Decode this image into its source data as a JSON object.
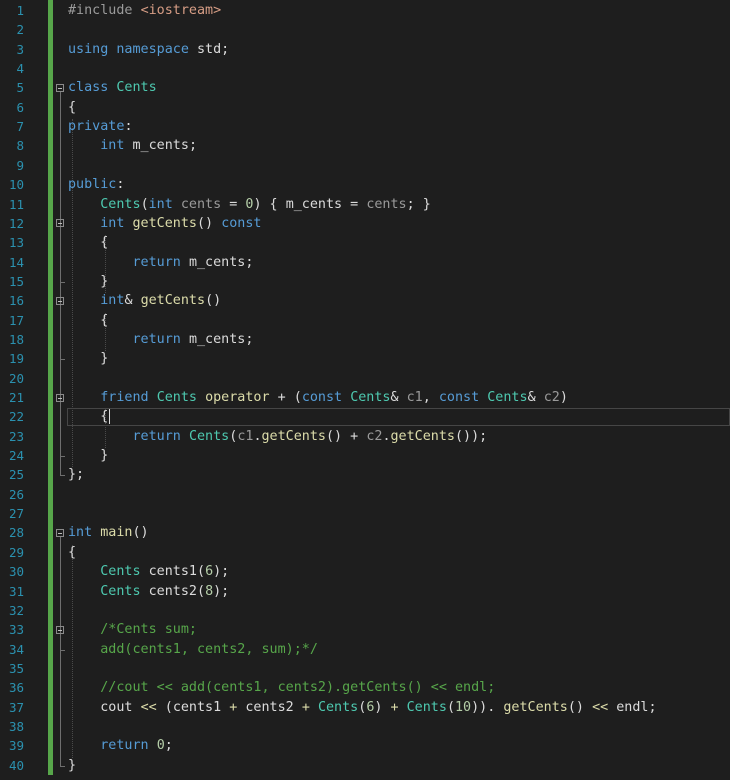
{
  "editor": {
    "line_numbers": [
      "1",
      "2",
      "3",
      "4",
      "5",
      "6",
      "7",
      "8",
      "9",
      "10",
      "11",
      "12",
      "13",
      "14",
      "15",
      "16",
      "17",
      "18",
      "19",
      "20",
      "21",
      "22",
      "23",
      "24",
      "25",
      "26",
      "27",
      "28",
      "29",
      "30",
      "31",
      "32",
      "33",
      "34",
      "35",
      "36",
      "37",
      "38",
      "39",
      "40"
    ],
    "current_line": 22,
    "lines": [
      [
        [
          "pp",
          "#include "
        ],
        [
          "st",
          "<iostream>"
        ]
      ],
      [],
      [
        [
          "kw",
          "using"
        ],
        [
          "tx",
          " "
        ],
        [
          "kw",
          "namespace"
        ],
        [
          "tx",
          " std;"
        ]
      ],
      [],
      [
        [
          "kw",
          "class"
        ],
        [
          "tx",
          " "
        ],
        [
          "ty",
          "Cents"
        ]
      ],
      [
        [
          "tx",
          "{"
        ]
      ],
      [
        [
          "kw",
          "private"
        ],
        [
          "tx",
          ":"
        ]
      ],
      [
        [
          "tx",
          "    "
        ],
        [
          "kw",
          "int"
        ],
        [
          "tx",
          " "
        ],
        [
          "mb",
          "m_cents"
        ],
        [
          "tx",
          ";"
        ]
      ],
      [],
      [
        [
          "kw",
          "public"
        ],
        [
          "tx",
          ":"
        ]
      ],
      [
        [
          "tx",
          "    "
        ],
        [
          "ty",
          "Cents"
        ],
        [
          "tx",
          "("
        ],
        [
          "kw",
          "int"
        ],
        [
          "tx",
          " "
        ],
        [
          "pm",
          "cents"
        ],
        [
          "tx",
          " = "
        ],
        [
          "nm",
          "0"
        ],
        [
          "tx",
          ") { "
        ],
        [
          "mb",
          "m_cents"
        ],
        [
          "tx",
          " = "
        ],
        [
          "pm",
          "cents"
        ],
        [
          "tx",
          "; }"
        ]
      ],
      [
        [
          "tx",
          "    "
        ],
        [
          "kw",
          "int"
        ],
        [
          "tx",
          " "
        ],
        [
          "fn",
          "getCents"
        ],
        [
          "tx",
          "() "
        ],
        [
          "kw",
          "const"
        ]
      ],
      [
        [
          "tx",
          "    {"
        ]
      ],
      [
        [
          "tx",
          "        "
        ],
        [
          "kw",
          "return"
        ],
        [
          "tx",
          " "
        ],
        [
          "mb",
          "m_cents"
        ],
        [
          "tx",
          ";"
        ]
      ],
      [
        [
          "tx",
          "    }"
        ]
      ],
      [
        [
          "tx",
          "    "
        ],
        [
          "kw",
          "int"
        ],
        [
          "tx",
          "& "
        ],
        [
          "fn",
          "getCents"
        ],
        [
          "tx",
          "()"
        ]
      ],
      [
        [
          "tx",
          "    {"
        ]
      ],
      [
        [
          "tx",
          "        "
        ],
        [
          "kw",
          "return"
        ],
        [
          "tx",
          " "
        ],
        [
          "mb",
          "m_cents"
        ],
        [
          "tx",
          ";"
        ]
      ],
      [
        [
          "tx",
          "    }"
        ]
      ],
      [],
      [
        [
          "tx",
          "    "
        ],
        [
          "kw",
          "friend"
        ],
        [
          "tx",
          " "
        ],
        [
          "ty",
          "Cents"
        ],
        [
          "tx",
          " "
        ],
        [
          "fn",
          "operator"
        ],
        [
          "tx",
          " + ("
        ],
        [
          "kw",
          "const"
        ],
        [
          "tx",
          " "
        ],
        [
          "ty",
          "Cents"
        ],
        [
          "tx",
          "& "
        ],
        [
          "pm",
          "c1"
        ],
        [
          "tx",
          ", "
        ],
        [
          "kw",
          "const"
        ],
        [
          "tx",
          " "
        ],
        [
          "ty",
          "Cents"
        ],
        [
          "tx",
          "& "
        ],
        [
          "pm",
          "c2"
        ],
        [
          "tx",
          ")"
        ]
      ],
      [
        [
          "tx",
          "    {"
        ]
      ],
      [
        [
          "tx",
          "        "
        ],
        [
          "kw",
          "return"
        ],
        [
          "tx",
          " "
        ],
        [
          "ty",
          "Cents"
        ],
        [
          "tx",
          "("
        ],
        [
          "pm",
          "c1"
        ],
        [
          "tx",
          "."
        ],
        [
          "fn",
          "getCents"
        ],
        [
          "tx",
          "() + "
        ],
        [
          "pm",
          "c2"
        ],
        [
          "tx",
          "."
        ],
        [
          "fn",
          "getCents"
        ],
        [
          "tx",
          "());"
        ]
      ],
      [
        [
          "tx",
          "    }"
        ]
      ],
      [
        [
          "tx",
          "};"
        ]
      ],
      [],
      [],
      [
        [
          "kw",
          "int"
        ],
        [
          "tx",
          " "
        ],
        [
          "fn",
          "main"
        ],
        [
          "tx",
          "()"
        ]
      ],
      [
        [
          "tx",
          "{"
        ]
      ],
      [
        [
          "tx",
          "    "
        ],
        [
          "ty",
          "Cents"
        ],
        [
          "tx",
          " "
        ],
        [
          "tx",
          "cents1"
        ],
        [
          "tx",
          "("
        ],
        [
          "nm",
          "6"
        ],
        [
          "tx",
          ");"
        ]
      ],
      [
        [
          "tx",
          "    "
        ],
        [
          "ty",
          "Cents"
        ],
        [
          "tx",
          " "
        ],
        [
          "tx",
          "cents2"
        ],
        [
          "tx",
          "("
        ],
        [
          "nm",
          "8"
        ],
        [
          "tx",
          ");"
        ]
      ],
      [],
      [
        [
          "tx",
          "    "
        ],
        [
          "cm",
          "/*Cents sum;"
        ]
      ],
      [
        [
          "tx",
          "    "
        ],
        [
          "cm",
          "add(cents1, cents2, sum);*/"
        ]
      ],
      [],
      [
        [
          "tx",
          "    "
        ],
        [
          "cm",
          "//cout << add(cents1, cents2).getCents() << endl;"
        ]
      ],
      [
        [
          "tx",
          "    "
        ],
        [
          "tx",
          "cout"
        ],
        [
          "tx",
          " "
        ],
        [
          "fn",
          "<<"
        ],
        [
          "tx",
          " ("
        ],
        [
          "tx",
          "cents1"
        ],
        [
          "tx",
          " "
        ],
        [
          "fn",
          "+"
        ],
        [
          "tx",
          " "
        ],
        [
          "tx",
          "cents2"
        ],
        [
          "tx",
          " "
        ],
        [
          "fn",
          "+"
        ],
        [
          "tx",
          " "
        ],
        [
          "ty",
          "Cents"
        ],
        [
          "tx",
          "("
        ],
        [
          "nm",
          "6"
        ],
        [
          "tx",
          ") "
        ],
        [
          "fn",
          "+"
        ],
        [
          "tx",
          " "
        ],
        [
          "ty",
          "Cents"
        ],
        [
          "tx",
          "("
        ],
        [
          "nm",
          "10"
        ],
        [
          "tx",
          ")). "
        ],
        [
          "fn",
          "getCents"
        ],
        [
          "tx",
          "() "
        ],
        [
          "fn",
          "<<"
        ],
        [
          "tx",
          " endl;"
        ]
      ],
      [],
      [
        [
          "tx",
          "    "
        ],
        [
          "kw",
          "return"
        ],
        [
          "tx",
          " "
        ],
        [
          "nm",
          "0"
        ],
        [
          "tx",
          ";"
        ]
      ],
      [
        [
          "tx",
          "}"
        ]
      ]
    ]
  },
  "fold_icon_label": "−",
  "colors": {
    "background": "#1e1e1e",
    "line_number": "#2b91af",
    "keyword": "#569cd6",
    "type": "#4ec9b0",
    "function": "#dcdcaa",
    "number": "#b5cea8",
    "comment": "#57a64a",
    "string": "#d69d85",
    "change_bar": "#57a64a"
  }
}
